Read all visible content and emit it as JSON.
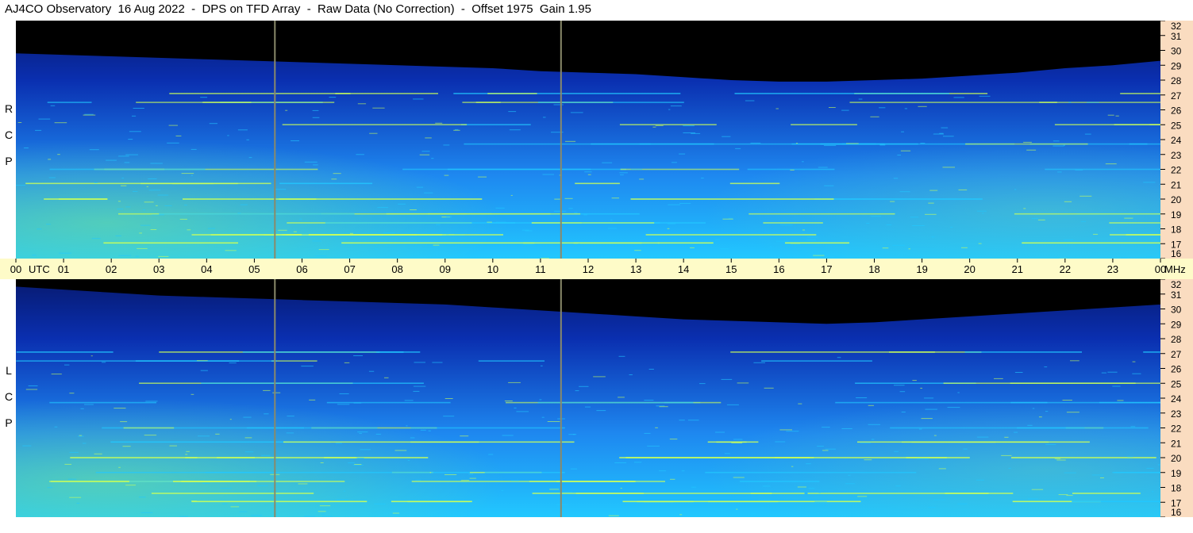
{
  "title": "AJ4CO Observatory  16 Aug 2022  -  DPS on TFD Array  -  Raw Data (No Correction)  -  Offset 1975  Gain 1.95",
  "panels": [
    {
      "id": "rcp",
      "letters": [
        "R",
        "C",
        "P"
      ]
    },
    {
      "id": "lcp",
      "letters": [
        "L",
        "C",
        "P"
      ]
    }
  ],
  "colors": {
    "background_strip_freq": "#fadcc0",
    "background_strip_time": "#fefbc8",
    "sky_dark": "#000000",
    "spectrum_low": "#0a2fb0",
    "spectrum_mid": "#1e88f0",
    "spectrum_high": "#22c8ff",
    "interference": "#c8ff5a",
    "marker_line": "#8a8a6a"
  },
  "chart_data": {
    "type": "heatmap",
    "title": "AJ4CO Observatory  16 Aug 2022  -  DPS on TFD Array  -  Raw Data (No Correction)  -  Offset 1975  Gain 1.95",
    "x_ticks": [
      "00",
      "01",
      "02",
      "03",
      "04",
      "05",
      "06",
      "07",
      "08",
      "09",
      "10",
      "11",
      "12",
      "13",
      "14",
      "15",
      "16",
      "17",
      "18",
      "19",
      "20",
      "21",
      "22",
      "23",
      "00"
    ],
    "x_unit_label": "UTC",
    "x_range": [
      0,
      24
    ],
    "y_ticks": [
      "16",
      "17",
      "18",
      "19",
      "20",
      "21",
      "22",
      "23",
      "24",
      "25",
      "26",
      "27",
      "28",
      "29",
      "30",
      "31",
      "32"
    ],
    "y_unit_label": "MHz",
    "y_range": [
      16,
      32
    ],
    "marker_times": [
      5.43,
      11.43
    ],
    "interference_bands": [
      {
        "freq": 17.05,
        "strength": 0.9
      },
      {
        "freq": 17.6,
        "strength": 0.75
      },
      {
        "freq": 18.4,
        "strength": 0.55
      },
      {
        "freq": 19.0,
        "strength": 0.5
      },
      {
        "freq": 20.0,
        "strength": 0.85
      },
      {
        "freq": 21.05,
        "strength": 0.7
      },
      {
        "freq": 22.0,
        "strength": 0.35
      },
      {
        "freq": 23.7,
        "strength": 0.35
      },
      {
        "freq": 25.0,
        "strength": 0.5
      },
      {
        "freq": 26.5,
        "strength": 0.4
      },
      {
        "freq": 27.1,
        "strength": 0.6
      }
    ],
    "panels": [
      {
        "polarization": "RCP",
        "cutoff_mhz": [
          29.8,
          29.7,
          29.6,
          29.5,
          29.4,
          29.3,
          29.2,
          29.1,
          29.0,
          28.9,
          28.8,
          28.6,
          28.5,
          28.4,
          28.2,
          28.0,
          27.9,
          27.9,
          28.0,
          28.1,
          28.3,
          28.5,
          28.8,
          29.0,
          29.3
        ]
      },
      {
        "polarization": "LCP",
        "cutoff_mhz": [
          31.5,
          31.3,
          31.1,
          30.9,
          30.8,
          30.7,
          30.6,
          30.5,
          30.4,
          30.3,
          30.1,
          29.9,
          29.7,
          29.5,
          29.3,
          29.2,
          29.1,
          29.0,
          29.1,
          29.3,
          29.5,
          29.7,
          29.9,
          30.1,
          30.3
        ]
      }
    ]
  }
}
